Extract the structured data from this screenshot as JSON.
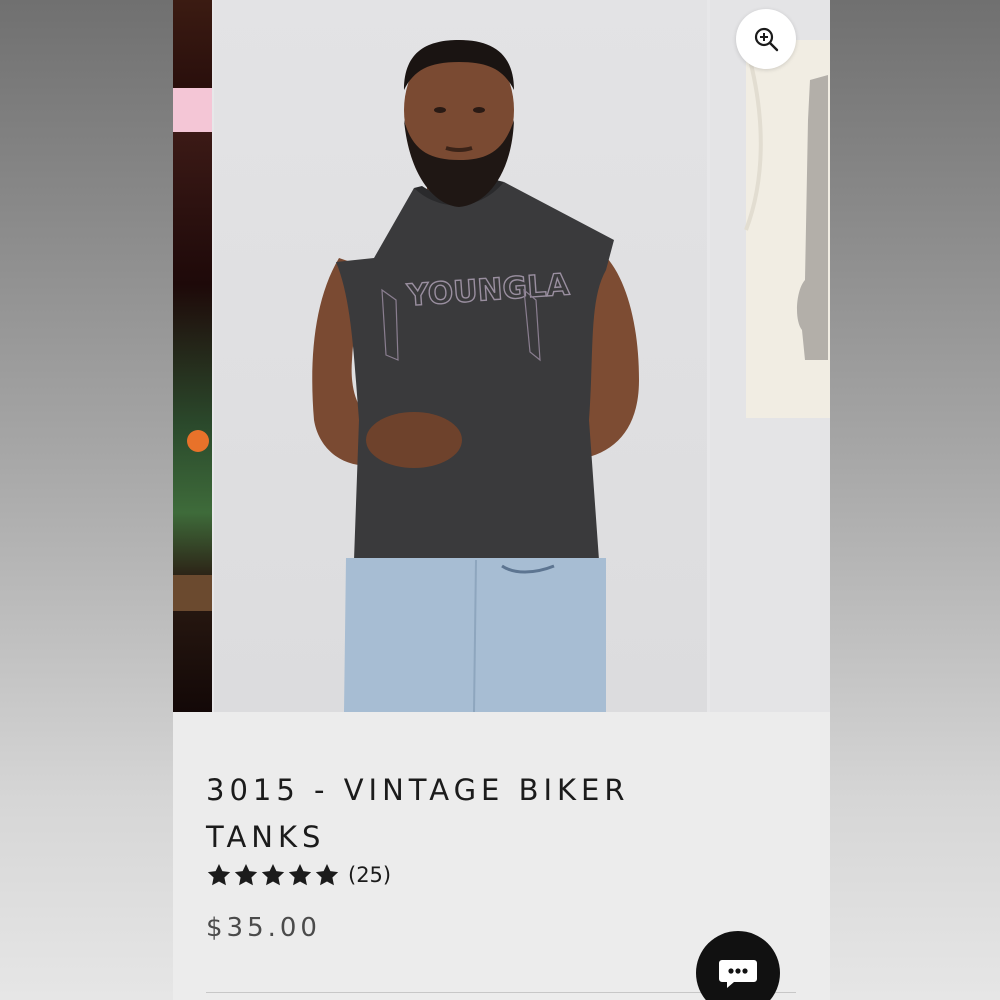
{
  "product": {
    "title": "3015 - VINTAGE BIKER TANKS",
    "rating": 5,
    "review_count": "(25)",
    "price": "$35.00"
  },
  "gallery": {
    "main_image_shirt_text": "YOUNGLA",
    "icons": {
      "zoom": "zoom-in-icon",
      "chat": "chat-icon"
    }
  },
  "colors": {
    "text": "#1b1b1b",
    "price": "#4b4b4b",
    "chat_button": "#111111",
    "background": "#ececec"
  }
}
